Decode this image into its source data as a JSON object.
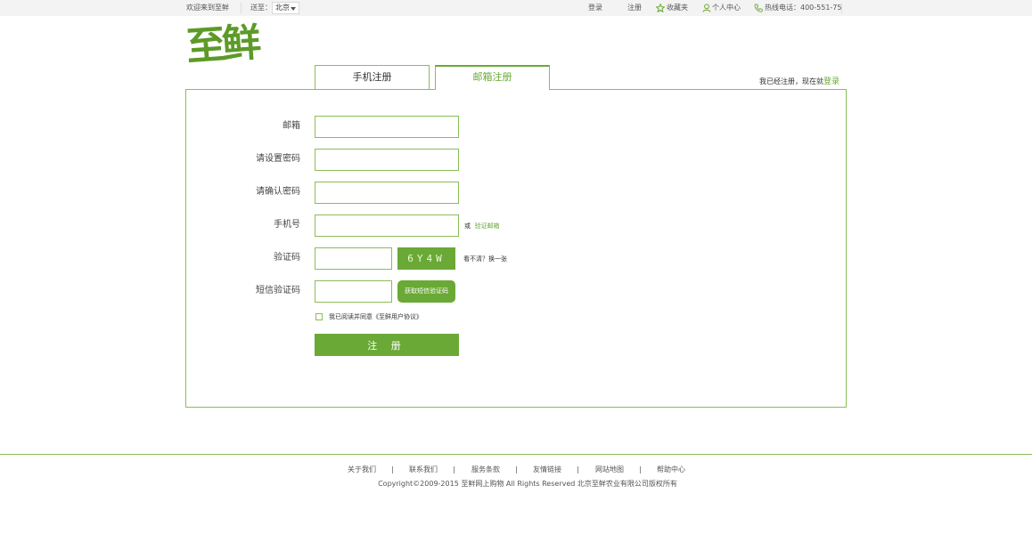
{
  "topbar": {
    "welcome": "欢迎来到至鲜",
    "deliver_label": "送至：",
    "city": "北京",
    "login": "登录",
    "register": "注册",
    "favorites": "收藏夹",
    "user_center": "个人中心",
    "hotline": "热线电话：400-551-75"
  },
  "logo": {
    "text": "至鲜"
  },
  "tabs": [
    {
      "label": "手机注册",
      "active": false
    },
    {
      "label": "邮箱注册",
      "active": true
    }
  ],
  "already": {
    "text": "我已经注册，现在就",
    "link": "登录"
  },
  "form": {
    "email_label": "邮箱",
    "password_label": "请设置密码",
    "confirm_label": "请确认密码",
    "phone_label": "手机号",
    "phone_hint_prefix": "或",
    "phone_hint_link": "验证邮箱",
    "captcha_label": "验证码",
    "captcha_text": "6Y4W",
    "captcha_refresh": "看不清？换一张",
    "sms_label": "短信验证码",
    "sms_button": "获取短信验证码",
    "agree_text": "我已阅读并同意《至鲜用户协议》",
    "submit": "注 册"
  },
  "footer": {
    "links": [
      "关于我们",
      "联系我们",
      "服务条款",
      "友情链接",
      "网站地图",
      "帮助中心"
    ],
    "separator": "|",
    "copyright": "Copyright©2009-2015 至鲜网上购物 All Rights Reserved 北京至鲜农业有限公司版权所有"
  },
  "colors": {
    "accent": "#6aa936",
    "border": "#8bbd57",
    "topbar_bg": "#f3f3f3"
  },
  "icons": [
    "star-icon",
    "user-icon",
    "phone-icon",
    "caret-down-icon"
  ]
}
